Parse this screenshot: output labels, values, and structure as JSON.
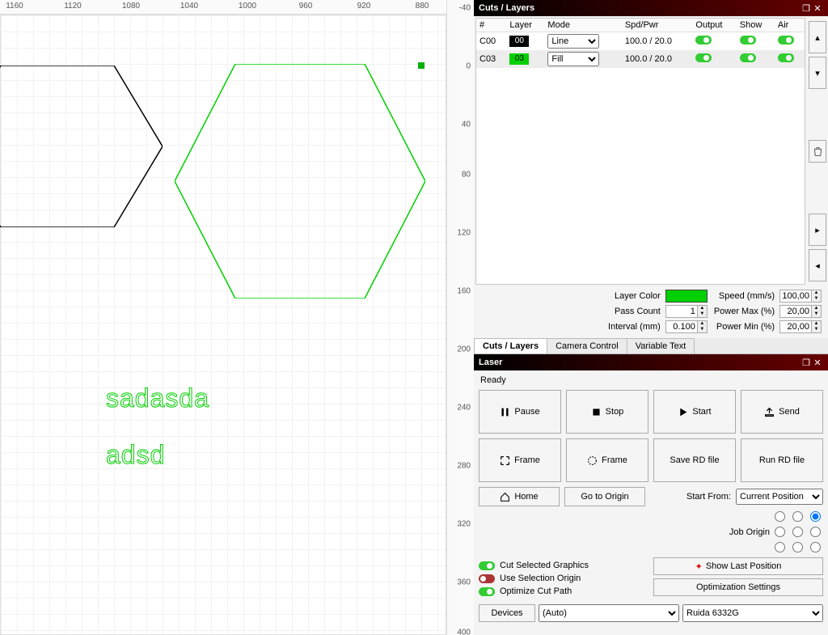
{
  "ruler_x": [
    "1160",
    "1120",
    "1080",
    "1040",
    "1000",
    "960",
    "920",
    "880"
  ],
  "ruler_y": [
    "-40",
    "0",
    "40",
    "80",
    "120",
    "160",
    "200",
    "240",
    "280",
    "320",
    "360",
    "400"
  ],
  "canvas_text_1": "sadasda",
  "canvas_text_2": "adsd",
  "cuts_panel": {
    "title": "Cuts / Layers",
    "headers": [
      "#",
      "Layer",
      "Mode",
      "Spd/Pwr",
      "Output",
      "Show",
      "Air"
    ],
    "rows": [
      {
        "id": "C00",
        "layer": "00",
        "mode": "Line",
        "spdpwr": "100.0 / 20.0",
        "output": true,
        "show": true,
        "air": true,
        "swatch": "black"
      },
      {
        "id": "C03",
        "layer": "03",
        "mode": "Fill",
        "spdpwr": "100.0 / 20.0",
        "output": true,
        "show": true,
        "air": true,
        "swatch": "green"
      }
    ],
    "props": {
      "layer_color_label": "Layer Color",
      "pass_count_label": "Pass Count",
      "pass_count": "1",
      "interval_label": "Interval (mm)",
      "interval": "0.100",
      "speed_label": "Speed (mm/s)",
      "speed": "100,00",
      "pmax_label": "Power Max (%)",
      "pmax": "20,00",
      "pmin_label": "Power Min (%)",
      "pmin": "20,00"
    }
  },
  "tabs": {
    "cuts": "Cuts / Layers",
    "camera": "Camera Control",
    "vartext": "Variable Text"
  },
  "laser": {
    "title": "Laser",
    "ready": "Ready",
    "pause": "Pause",
    "stop": "Stop",
    "start": "Start",
    "send": "Send",
    "frame1": "Frame",
    "frame2": "Frame",
    "saverd": "Save RD file",
    "runrd": "Run RD file",
    "home": "Home",
    "goto": "Go to Origin",
    "startfrom_label": "Start From:",
    "startfrom": "Current Position",
    "joborigin_label": "Job Origin",
    "cut_selected": "Cut Selected Graphics",
    "use_sel_origin": "Use Selection Origin",
    "optimize": "Optimize Cut Path",
    "show_last": "Show Last Position",
    "opt_settings": "Optimization Settings",
    "devices": "Devices",
    "auto": "(Auto)",
    "controller": "Ruida 6332G"
  }
}
